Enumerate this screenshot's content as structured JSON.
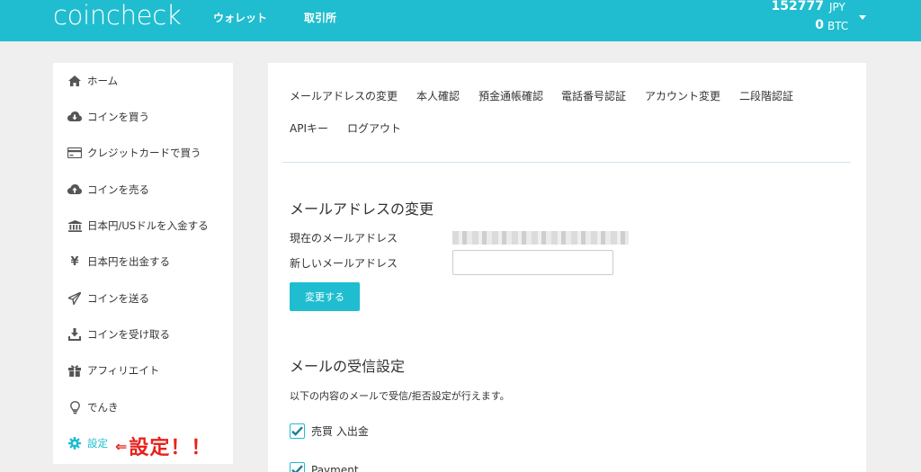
{
  "header": {
    "logo": "coincheck",
    "nav": [
      {
        "label": "ウォレット"
      },
      {
        "label": "取引所"
      }
    ],
    "balances": [
      {
        "amount": "152777",
        "currency": "JPY"
      },
      {
        "amount": "0",
        "currency": "BTC"
      }
    ],
    "accent_color": "#1fbdcf"
  },
  "sidebar": {
    "items": [
      {
        "label": "ホーム",
        "icon": "home-icon"
      },
      {
        "label": "コインを買う",
        "icon": "cloud-download-icon"
      },
      {
        "label": "クレジットカードで買う",
        "icon": "credit-card-icon"
      },
      {
        "label": "コインを売る",
        "icon": "cloud-upload-icon"
      },
      {
        "label": "日本円/USドルを入金する",
        "icon": "bank-icon"
      },
      {
        "label": "日本円を出金する",
        "icon": "yen-icon"
      },
      {
        "label": "コインを送る",
        "icon": "send-icon"
      },
      {
        "label": "コインを受け取る",
        "icon": "download-icon"
      },
      {
        "label": "アフィリエイト",
        "icon": "gift-icon"
      },
      {
        "label": "でんき",
        "icon": "lightbulb-icon"
      },
      {
        "label": "設定",
        "icon": "gear-icon",
        "active": true
      }
    ],
    "annotation": {
      "arrow": "⇐",
      "text": "設定！！",
      "color": "#e8211b"
    }
  },
  "main": {
    "tabs": [
      {
        "label": "メールアドレスの変更"
      },
      {
        "label": "本人確認"
      },
      {
        "label": "預金通帳確認"
      },
      {
        "label": "電話番号認証"
      },
      {
        "label": "アカウント変更"
      },
      {
        "label": "二段階認証"
      },
      {
        "label": "APIキー"
      },
      {
        "label": "ログアウト"
      }
    ],
    "email_section": {
      "title": "メールアドレスの変更",
      "current_label": "現在のメールアドレス",
      "new_label": "新しいメールアドレス",
      "new_value": "",
      "submit_label": "変更する"
    },
    "mail_section": {
      "title": "メールの受信設定",
      "description": "以下の内容のメールで受信/拒否設定が行えます。",
      "options": [
        {
          "label": "売買 入出金",
          "checked": true
        },
        {
          "label": "Payment",
          "checked": true
        }
      ]
    }
  }
}
